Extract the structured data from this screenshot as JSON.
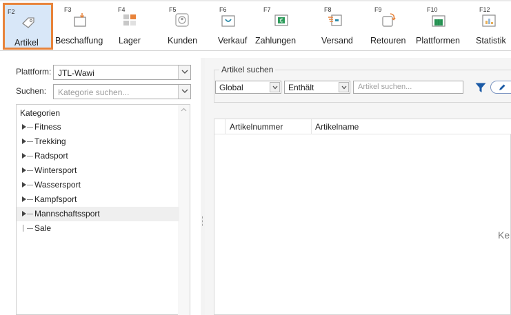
{
  "ribbon": {
    "buttons": [
      {
        "key": "F2",
        "label": "Artikel",
        "icon": "article-tag-icon",
        "active": true
      },
      {
        "key": "F3",
        "label": "Beschaffung",
        "icon": "procurement-box-icon"
      },
      {
        "key": "F4",
        "label": "Lager",
        "icon": "warehouse-blocks-icon"
      },
      {
        "key": "F5",
        "label": "Kunden",
        "icon": "customer-person-icon"
      },
      {
        "key": "F6",
        "label": "Verkauf",
        "icon": "sales-cart-icon"
      },
      {
        "key": "F7",
        "label": "Zahlungen",
        "icon": "payment-euro-icon"
      },
      {
        "key": "F8",
        "label": "Versand",
        "icon": "shipping-truck-icon"
      },
      {
        "key": "F9",
        "label": "Retouren",
        "icon": "returns-arrow-icon"
      },
      {
        "key": "F10",
        "label": "Plattformen",
        "icon": "platform-store-icon"
      },
      {
        "key": "F12",
        "label": "Statistik",
        "icon": "statistics-chart-icon"
      }
    ],
    "accent_color": "#e8833a"
  },
  "left": {
    "platform_label": "Plattform:",
    "platform_value": "JTL-Wawi",
    "search_label": "Suchen:",
    "search_placeholder": "Kategorie suchen...",
    "tree_header": "Kategorien",
    "categories": [
      {
        "label": "Fitness",
        "expandable": true
      },
      {
        "label": "Trekking",
        "expandable": true
      },
      {
        "label": "Radsport",
        "expandable": true
      },
      {
        "label": "Wintersport",
        "expandable": true
      },
      {
        "label": "Wassersport",
        "expandable": true
      },
      {
        "label": "Kampfsport",
        "expandable": true
      },
      {
        "label": "Mannschaftssport",
        "expandable": true,
        "selected": true
      },
      {
        "label": "Sale",
        "expandable": false
      }
    ]
  },
  "right": {
    "group_title": "Artikel suchen",
    "scope_value": "Global",
    "match_value": "Enthält",
    "search_placeholder": "Artikel suchen...",
    "columns": [
      "Artikelnummer",
      "Artikelname"
    ],
    "empty_text": "Ke"
  }
}
